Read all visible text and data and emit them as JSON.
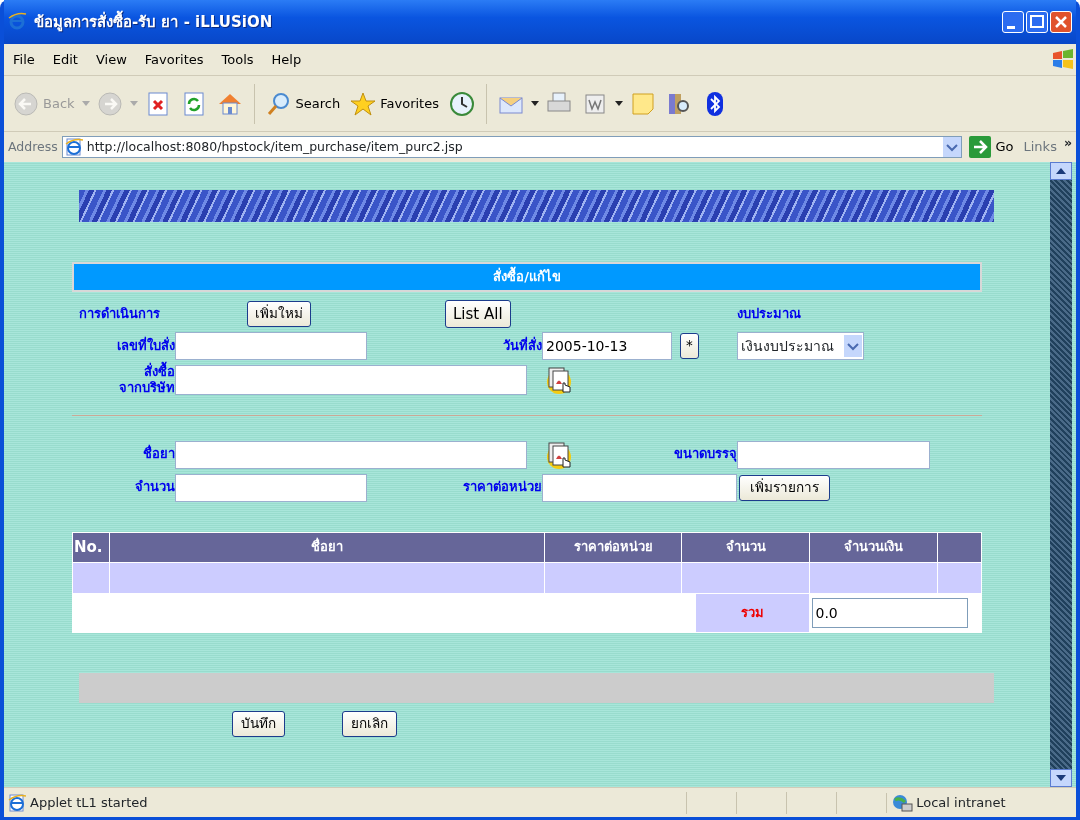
{
  "window": {
    "title": "ข้อมูลการสั่งซื้อ-รับ ยา - iLLUSiON"
  },
  "menu": [
    "File",
    "Edit",
    "View",
    "Favorites",
    "Tools",
    "Help"
  ],
  "toolbar": [
    {
      "kind": "back",
      "label": "Back",
      "disabled": true
    },
    {
      "kind": "forward",
      "disabled": true
    },
    {
      "kind": "stop",
      "disabled": false
    },
    {
      "kind": "refresh",
      "disabled": false
    },
    {
      "kind": "home",
      "disabled": false
    },
    {
      "kind": "search",
      "label": "Search",
      "disabled": false
    },
    {
      "kind": "favorites",
      "label": "Favorites",
      "disabled": false
    },
    {
      "kind": "history",
      "disabled": false
    },
    {
      "kind": "mail",
      "disabled": false
    },
    {
      "kind": "print",
      "disabled": false
    },
    {
      "kind": "word",
      "disabled": false
    },
    {
      "kind": "note",
      "disabled": false
    },
    {
      "kind": "research",
      "disabled": false
    },
    {
      "kind": "bluetooth",
      "disabled": false
    }
  ],
  "address": {
    "label": "Address",
    "url": "http://localhost:8080/hpstock/item_purchase/item_purc2.jsp",
    "go": "Go",
    "links": "Links",
    "more": "»"
  },
  "page": {
    "heading": "สั่งซื้อ/แก้ไข",
    "form": {
      "action_label": "การดำเนินการ",
      "new_button": "เพิ่มใหม่",
      "list_button": "List All",
      "budget_label": "งบประมาณ",
      "order_no_label": "เลขที่ใบสั่ง",
      "order_date_label": "วันที่สั่ง",
      "order_date": "2005-10-13",
      "date_button": "*",
      "budget_value": "เงินงบประมาณ",
      "supplier_label": "สั่งซื้อ\nจากบริษัท",
      "drug_label": "ชื่อยา",
      "pack_label": "ขนาดบรรจุ",
      "qty_label": "จำนวน",
      "price_label": "ราคาต่อหน่วย",
      "add_button": "เพิ่มรายการ"
    },
    "table": {
      "columns": [
        "No.",
        "ชื่อยา",
        "ราคาต่อหน่วย",
        "จำนวน",
        "จำนวนเงิน"
      ],
      "total_label": "รวม",
      "total": "0.0"
    },
    "buttons": [
      "บันทึก",
      "ยกเลิก"
    ]
  },
  "status_bar": {
    "text": "Applet tL1 started",
    "zone": "Local intranet"
  }
}
